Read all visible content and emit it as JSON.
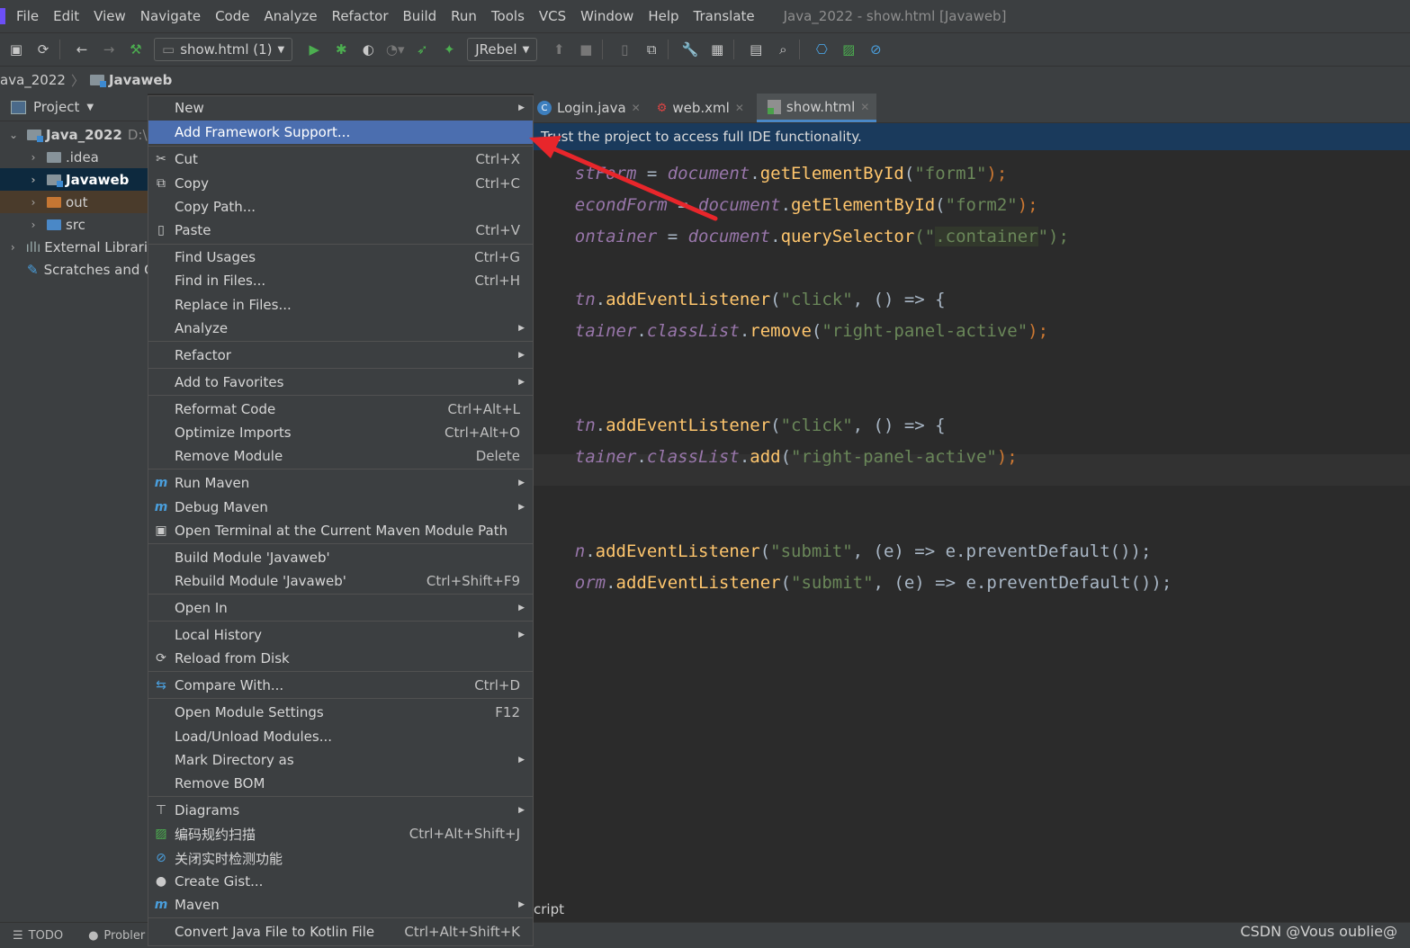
{
  "menubar": {
    "items": [
      "File",
      "Edit",
      "View",
      "Navigate",
      "Code",
      "Analyze",
      "Refactor",
      "Build",
      "Run",
      "Tools",
      "VCS",
      "Window",
      "Help",
      "Translate"
    ],
    "title": "Java_2022 - show.html [Javaweb]"
  },
  "toolbar": {
    "run_config": "show.html (1)",
    "jrebel": "JRebel"
  },
  "breadcrumb": {
    "project": "ava_2022",
    "module": "Javaweb"
  },
  "project_panel": {
    "header": "Project",
    "rows": [
      {
        "label": "Java_2022",
        "suffix": "D:\\"
      },
      {
        "label": ".idea"
      },
      {
        "label": "Javaweb"
      },
      {
        "label": "out"
      },
      {
        "label": "src"
      },
      {
        "label": "External Librari"
      },
      {
        "label": "Scratches and C"
      }
    ]
  },
  "tabs": [
    {
      "label": "Login.java"
    },
    {
      "label": "web.xml"
    },
    {
      "label": "show.html"
    }
  ],
  "trust_banner": "Trust the project to access full IDE functionality.",
  "editor": {
    "lines": [
      {
        "a": "stForm",
        "b": " = ",
        "c": "document",
        "d": ".",
        "e": "getElementById",
        "f": "(",
        "g": "\"form1\"",
        "h": ");"
      },
      {
        "a": "econdForm",
        "b": " = ",
        "c": "document",
        "d": ".",
        "e": "getElementById",
        "f": "(",
        "g": "\"form2\"",
        "h": ");"
      },
      {
        "a": "ontainer",
        "b": " = ",
        "c": "document",
        "d": ".",
        "e": "querySelector",
        "f": "(\"",
        "g": ".container",
        "h": "\");"
      },
      {
        "a": "tn",
        "d": ".",
        "e": "addEventListener",
        "f": "(",
        "g": "\"click\"",
        "h": ", () => {"
      },
      {
        "a": "tainer",
        "d": ".",
        "c": "classList",
        "e": "remove",
        "f": "(",
        "g": "\"right-panel-active\"",
        "h": ");"
      },
      {
        "a": "tn",
        "d": ".",
        "e": "addEventListener",
        "f": "(",
        "g": "\"click\"",
        "h": ", () => {"
      },
      {
        "a": "tainer",
        "d": ".",
        "c": "classList",
        "e": "add",
        "f": "(",
        "g": "\"right-panel-active\"",
        "h": ");"
      },
      {
        "a": "n",
        "d": ".",
        "e": "addEventListener",
        "f": "(",
        "g": "\"submit\"",
        "h": ", (e) => e.preventDefault());"
      },
      {
        "a": "orm",
        "d": ".",
        "e": "addEventListener",
        "f": "(",
        "g": "\"submit\"",
        "h": ", (e) => e.preventDefault());"
      }
    ],
    "crumb": "cript"
  },
  "context_menu": [
    {
      "label": "New",
      "submenu": true
    },
    {
      "label": "Add Framework Support...",
      "highlight": true
    },
    {
      "label": "Cut",
      "shortcut": "Ctrl+X",
      "icon": "scissors-icon"
    },
    {
      "label": "Copy",
      "shortcut": "Ctrl+C",
      "icon": "copy-icon"
    },
    {
      "label": "Copy Path..."
    },
    {
      "label": "Paste",
      "shortcut": "Ctrl+V",
      "icon": "paste-icon"
    },
    {
      "label": "Find Usages",
      "shortcut": "Ctrl+G"
    },
    {
      "label": "Find in Files...",
      "shortcut": "Ctrl+H"
    },
    {
      "label": "Replace in Files..."
    },
    {
      "label": "Analyze",
      "submenu": true
    },
    {
      "label": "Refactor",
      "submenu": true
    },
    {
      "label": "Add to Favorites",
      "submenu": true
    },
    {
      "label": "Reformat Code",
      "shortcut": "Ctrl+Alt+L"
    },
    {
      "label": "Optimize Imports",
      "shortcut": "Ctrl+Alt+O"
    },
    {
      "label": "Remove Module",
      "shortcut": "Delete"
    },
    {
      "label": "Run Maven",
      "submenu": true,
      "icon": "maven-run-icon"
    },
    {
      "label": "Debug Maven",
      "submenu": true,
      "icon": "maven-debug-icon"
    },
    {
      "label": "Open Terminal at the Current Maven Module Path",
      "icon": "terminal-icon"
    },
    {
      "label": "Build Module 'Javaweb'"
    },
    {
      "label": "Rebuild Module 'Javaweb'",
      "shortcut": "Ctrl+Shift+F9"
    },
    {
      "label": "Open In",
      "submenu": true
    },
    {
      "label": "Local History",
      "submenu": true
    },
    {
      "label": "Reload from Disk",
      "icon": "reload-icon"
    },
    {
      "label": "Compare With...",
      "shortcut": "Ctrl+D",
      "icon": "compare-icon"
    },
    {
      "label": "Open Module Settings",
      "shortcut": "F12"
    },
    {
      "label": "Load/Unload Modules..."
    },
    {
      "label": "Mark Directory as",
      "submenu": true
    },
    {
      "label": "Remove BOM"
    },
    {
      "label": "Diagrams",
      "submenu": true,
      "icon": "diagram-icon"
    },
    {
      "label": "编码规约扫描",
      "shortcut": "Ctrl+Alt+Shift+J",
      "icon": "scan-icon"
    },
    {
      "label": "关闭实时检测功能",
      "icon": "disable-icon"
    },
    {
      "label": "Create Gist...",
      "icon": "github-icon"
    },
    {
      "label": "Maven",
      "submenu": true,
      "icon": "maven-icon"
    },
    {
      "label": "Convert Java File to Kotlin File",
      "shortcut": "Ctrl+Alt+Shift+K"
    }
  ],
  "bottombar": {
    "todo": "TODO",
    "problems": "Probler"
  },
  "watermark": "CSDN @Vous oublie@",
  "colors": {
    "menu_highlight": "#4b6eaf",
    "annotation_arrow": "#e8262b"
  }
}
